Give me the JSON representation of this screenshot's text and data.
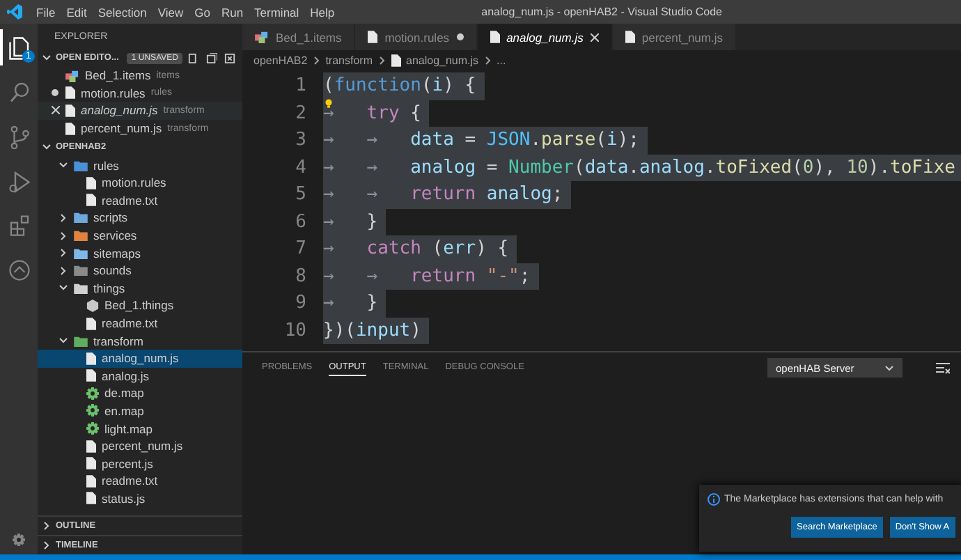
{
  "window": {
    "title": "analog_num.js - openHAB2 - Visual Studio Code"
  },
  "menu": [
    "File",
    "Edit",
    "Selection",
    "View",
    "Go",
    "Run",
    "Terminal",
    "Help"
  ],
  "activity_bar": [
    {
      "kind": "explorer",
      "selected": true,
      "badge": "1"
    },
    {
      "kind": "search",
      "selected": false
    },
    {
      "kind": "source-control",
      "selected": false
    },
    {
      "kind": "run",
      "selected": false
    },
    {
      "kind": "extensions",
      "selected": false
    },
    {
      "kind": "remote",
      "selected": false
    }
  ],
  "sidebar": {
    "title": "EXPLORER",
    "open_editors": {
      "title": "OPEN EDITO...",
      "badge": "1 UNSAVED",
      "items": [
        {
          "kind": "items",
          "name": "Bed_1.items",
          "folder": "items",
          "dirty": false,
          "hovered": false
        },
        {
          "kind": "file",
          "name": "motion.rules",
          "folder": "rules",
          "dirty": true,
          "hovered": false
        },
        {
          "kind": "file",
          "name": "analog_num.js",
          "folder": "transform",
          "dirty": false,
          "hovered": true
        },
        {
          "kind": "file",
          "name": "percent_num.js",
          "folder": "transform",
          "dirty": false,
          "hovered": false
        }
      ]
    },
    "workspace": {
      "title": "OPENHAB2",
      "tree": [
        {
          "kind": "folder",
          "name": "rules",
          "color": "#4a90d9",
          "expanded": true,
          "children": [
            {
              "kind": "file",
              "name": "motion.rules",
              "selected": false
            },
            {
              "kind": "file",
              "name": "readme.txt",
              "selected": false
            }
          ]
        },
        {
          "kind": "folder",
          "name": "scripts",
          "color": "#6fa8dc",
          "expanded": false
        },
        {
          "kind": "folder",
          "name": "services",
          "color": "#e0823d",
          "expanded": false
        },
        {
          "kind": "folder",
          "name": "sitemaps",
          "color": "#7fb8e8",
          "expanded": false
        },
        {
          "kind": "folder",
          "name": "sounds",
          "color": "#8a8a8a",
          "expanded": false
        },
        {
          "kind": "folder",
          "name": "things",
          "color": "#d0d0d0",
          "expanded": true,
          "children": [
            {
              "kind": "thing",
              "name": "Bed_1.things",
              "selected": false
            },
            {
              "kind": "file",
              "name": "readme.txt",
              "selected": false
            }
          ]
        },
        {
          "kind": "folder",
          "name": "transform",
          "color": "#5fae5f",
          "expanded": true,
          "children": [
            {
              "kind": "file",
              "name": "analog_num.js",
              "selected": true
            },
            {
              "kind": "file",
              "name": "analog.js",
              "selected": false
            },
            {
              "kind": "map",
              "name": "de.map",
              "selected": false
            },
            {
              "kind": "map",
              "name": "en.map",
              "selected": false
            },
            {
              "kind": "map",
              "name": "light.map",
              "selected": false
            },
            {
              "kind": "file",
              "name": "percent_num.js",
              "selected": false
            },
            {
              "kind": "file",
              "name": "percent.js",
              "selected": false
            },
            {
              "kind": "file",
              "name": "readme.txt",
              "selected": false
            },
            {
              "kind": "file",
              "name": "status.js",
              "selected": false
            }
          ]
        }
      ]
    },
    "sections": [
      "OUTLINE",
      "TIMELINE"
    ]
  },
  "tabs": [
    {
      "kind": "items",
      "label": "Bed_1.items",
      "selected": false,
      "dirty": false
    },
    {
      "kind": "file",
      "label": "motion.rules",
      "selected": false,
      "dirty": true
    },
    {
      "kind": "file",
      "label": "analog_num.js",
      "selected": true,
      "dirty": false
    },
    {
      "kind": "file",
      "label": "percent_num.js",
      "selected": false,
      "dirty": false
    }
  ],
  "breadcrumb": [
    "openHAB2",
    "transform",
    "analog_num.js",
    "..."
  ],
  "code": [
    {
      "number": "1",
      "tokens": [
        {
          "kind": "punct",
          "text": "("
        },
        {
          "kind": "storage",
          "text": "function"
        },
        {
          "kind": "punct",
          "text": "("
        },
        {
          "kind": "var",
          "text": "i"
        },
        {
          "kind": "punct",
          "text": ") {"
        }
      ]
    },
    {
      "number": "2",
      "bulb": true,
      "tokens": [
        {
          "kind": "tab",
          "text": "→"
        },
        {
          "kind": "kw",
          "text": "try"
        },
        {
          "kind": "punct",
          "text": " {"
        }
      ]
    },
    {
      "number": "3",
      "tokens": [
        {
          "kind": "tab",
          "text": "→"
        },
        {
          "kind": "tab",
          "text": "→"
        },
        {
          "kind": "var",
          "text": "data"
        },
        {
          "kind": "punct",
          "text": " = "
        },
        {
          "kind": "const",
          "text": "JSON"
        },
        {
          "kind": "punct",
          "text": "."
        },
        {
          "kind": "fn",
          "text": "parse"
        },
        {
          "kind": "punct",
          "text": "("
        },
        {
          "kind": "var",
          "text": "i"
        },
        {
          "kind": "punct",
          "text": ");"
        }
      ]
    },
    {
      "number": "4",
      "tokens": [
        {
          "kind": "tab",
          "text": "→"
        },
        {
          "kind": "tab",
          "text": "→"
        },
        {
          "kind": "var",
          "text": "analog"
        },
        {
          "kind": "punct",
          "text": " = "
        },
        {
          "kind": "cls",
          "text": "Number"
        },
        {
          "kind": "punct",
          "text": "("
        },
        {
          "kind": "var",
          "text": "data"
        },
        {
          "kind": "punct",
          "text": "."
        },
        {
          "kind": "var",
          "text": "analog"
        },
        {
          "kind": "punct",
          "text": "."
        },
        {
          "kind": "fn",
          "text": "toFixed"
        },
        {
          "kind": "punct",
          "text": "("
        },
        {
          "kind": "num",
          "text": "0"
        },
        {
          "kind": "punct",
          "text": "), "
        },
        {
          "kind": "num",
          "text": "10"
        },
        {
          "kind": "punct",
          "text": ")."
        },
        {
          "kind": "fn",
          "text": "toFixe"
        }
      ]
    },
    {
      "number": "5",
      "tokens": [
        {
          "kind": "tab",
          "text": "→"
        },
        {
          "kind": "tab",
          "text": "→"
        },
        {
          "kind": "kw",
          "text": "return "
        },
        {
          "kind": "var",
          "text": "analog"
        },
        {
          "kind": "punct",
          "text": ";"
        }
      ]
    },
    {
      "number": "6",
      "tokens": [
        {
          "kind": "tab",
          "text": "→"
        },
        {
          "kind": "punct",
          "text": "}"
        }
      ]
    },
    {
      "number": "7",
      "tokens": [
        {
          "kind": "tab",
          "text": "→"
        },
        {
          "kind": "kw",
          "text": "catch"
        },
        {
          "kind": "punct",
          "text": " ("
        },
        {
          "kind": "var",
          "text": "err"
        },
        {
          "kind": "punct",
          "text": ") {"
        }
      ]
    },
    {
      "number": "8",
      "tokens": [
        {
          "kind": "tab",
          "text": "→"
        },
        {
          "kind": "tab",
          "text": "→"
        },
        {
          "kind": "kw",
          "text": "return "
        },
        {
          "kind": "str",
          "text": "\"-\""
        },
        {
          "kind": "punct",
          "text": ";"
        }
      ]
    },
    {
      "number": "9",
      "tokens": [
        {
          "kind": "tab",
          "text": "→"
        },
        {
          "kind": "punct",
          "text": "}"
        }
      ]
    },
    {
      "number": "10",
      "tokens": [
        {
          "kind": "punct",
          "text": "})("
        },
        {
          "kind": "var",
          "text": "input"
        },
        {
          "kind": "punct",
          "text": ")"
        }
      ]
    }
  ],
  "panel": {
    "tabs": [
      {
        "label": "PROBLEMS",
        "selected": false
      },
      {
        "label": "OUTPUT",
        "selected": true
      },
      {
        "label": "TERMINAL",
        "selected": false
      },
      {
        "label": "DEBUG CONSOLE",
        "selected": false
      }
    ],
    "channel": "openHAB Server"
  },
  "notification": {
    "message": "The Marketplace has extensions that can help with",
    "buttons": [
      "Search Marketplace",
      "Don't Show A"
    ]
  }
}
